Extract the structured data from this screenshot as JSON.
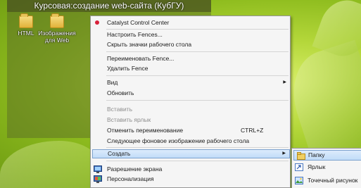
{
  "fence": {
    "title": "Курсовая:создание web-сайта (КубГУ)",
    "icons": [
      {
        "label": "HTML",
        "icon": "folder-icon"
      },
      {
        "label": "Изображения для Web",
        "icon": "folder-icon"
      }
    ]
  },
  "context_menu": {
    "items": [
      {
        "label": "Catalyst Control Center",
        "icon": "catalyst-icon"
      },
      {
        "label": "Настроить Fences..."
      },
      {
        "label": "Скрыть значки рабочего стола"
      },
      {
        "label": "Переименовать Fence..."
      },
      {
        "label": "Удалить Fence"
      },
      {
        "label": "Вид",
        "submenu": true
      },
      {
        "label": "Обновить"
      },
      {
        "label": "Вставить",
        "disabled": true
      },
      {
        "label": "Вставить ярлык",
        "disabled": true
      },
      {
        "label": "Отменить переименование",
        "shortcut": "CTRL+Z"
      },
      {
        "label": "Следующее фоновое изображение рабочего стола"
      },
      {
        "label": "Создать",
        "submenu": true,
        "highlighted": true
      },
      {
        "label": "Разрешение экрана",
        "icon": "screen-resolution-icon"
      },
      {
        "label": "Персонализация",
        "icon": "personalization-icon"
      }
    ]
  },
  "create_submenu": {
    "items": [
      {
        "label": "Папку",
        "icon": "folder-icon",
        "highlighted": true
      },
      {
        "label": "Ярлык",
        "icon": "shortcut-icon"
      },
      {
        "label": "Точечный рисунок",
        "icon": "bitmap-icon"
      }
    ]
  },
  "colors": {
    "highlight": "#c1dcf8",
    "highlight_border": "#7da2ce",
    "menu_bg": "#f5f5f5",
    "desktop": "#9cc42a"
  }
}
